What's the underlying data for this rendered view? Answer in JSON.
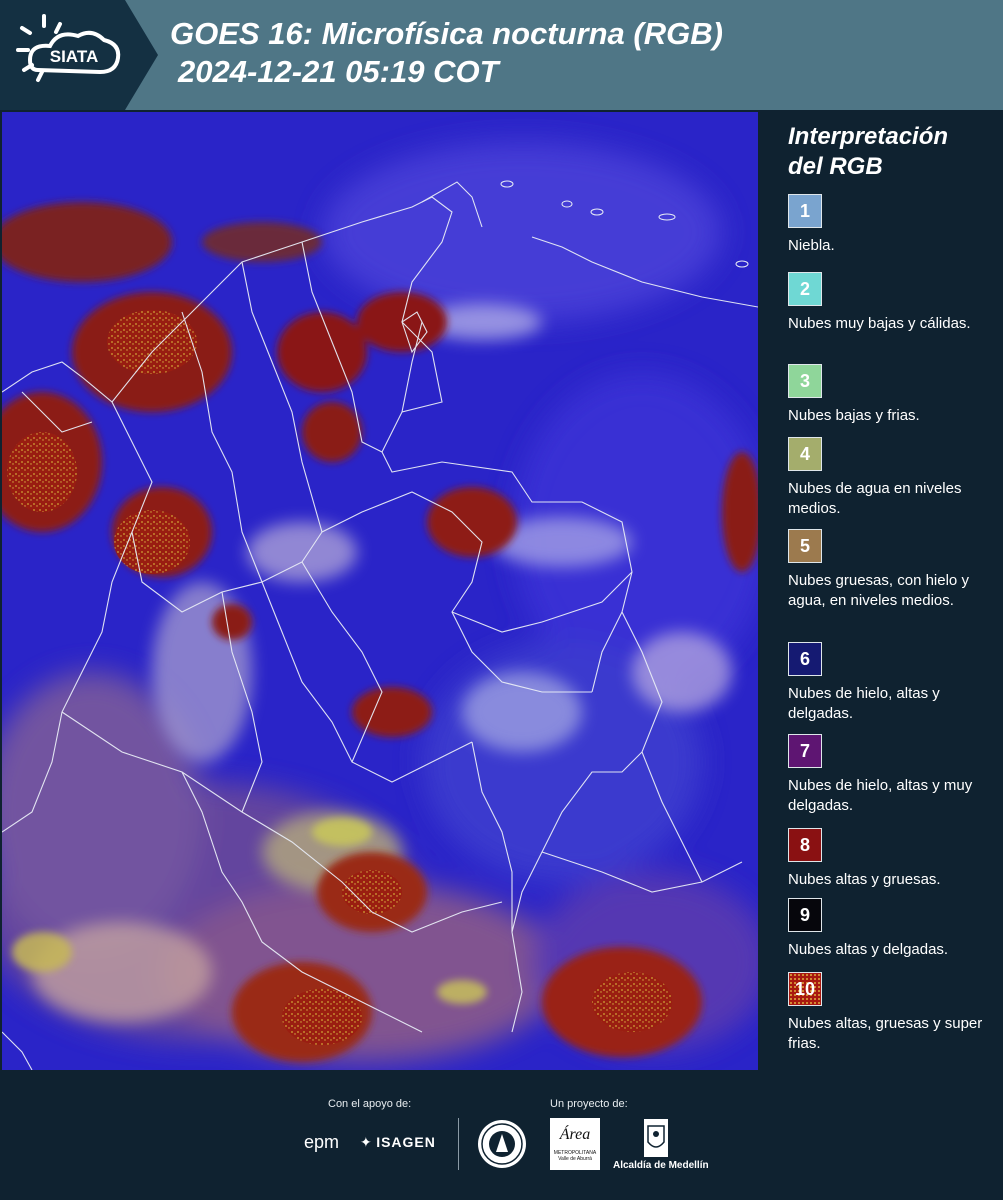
{
  "header": {
    "logo_text": "SIATA",
    "title_line1": "GOES 16: Microfísica nocturna (RGB)",
    "title_line2": "2024-12-21 05:19 COT"
  },
  "legend": {
    "title": "Interpretación del RGB",
    "items": [
      {
        "number": "1",
        "label": "Niebla.",
        "color": "#7aa4cf"
      },
      {
        "number": "2",
        "label": "Nubes muy bajas y cálidas.",
        "color": "#6fd8d4"
      },
      {
        "number": "3",
        "label": "Nubes bajas y frias.",
        "color": "#8fd69a"
      },
      {
        "number": "4",
        "label": "Nubes de agua en niveles medios.",
        "color": "#a4ad6c"
      },
      {
        "number": "5",
        "label": "Nubes gruesas, con hielo y agua, en niveles medios.",
        "color": "#9c7a4e"
      },
      {
        "number": "6",
        "label": "Nubes de hielo, altas y delgadas.",
        "color": "#151a72"
      },
      {
        "number": "7",
        "label": "Nubes de hielo, altas y muy delgadas.",
        "color": "#5e1572"
      },
      {
        "number": "8",
        "label": "Nubes altas y gruesas.",
        "color": "#8a1112"
      },
      {
        "number": "9",
        "label": "Nubes altas y delgadas.",
        "color": "#06060c"
      },
      {
        "number": "10",
        "label": "Nubes altas, gruesas y super frias.",
        "color": "#a8190f"
      }
    ]
  },
  "footer": {
    "support_label": "Con el apoyo de:",
    "project_label": "Un proyecto de:",
    "sponsor1": "epm",
    "sponsor2": "ISAGEN",
    "partner_area_main": "Área",
    "partner_area_sub1": "METROPOLITANA",
    "partner_area_sub2": "Valle de Aburrá",
    "partner_alcaldia": "Alcaldía de Medellín"
  }
}
